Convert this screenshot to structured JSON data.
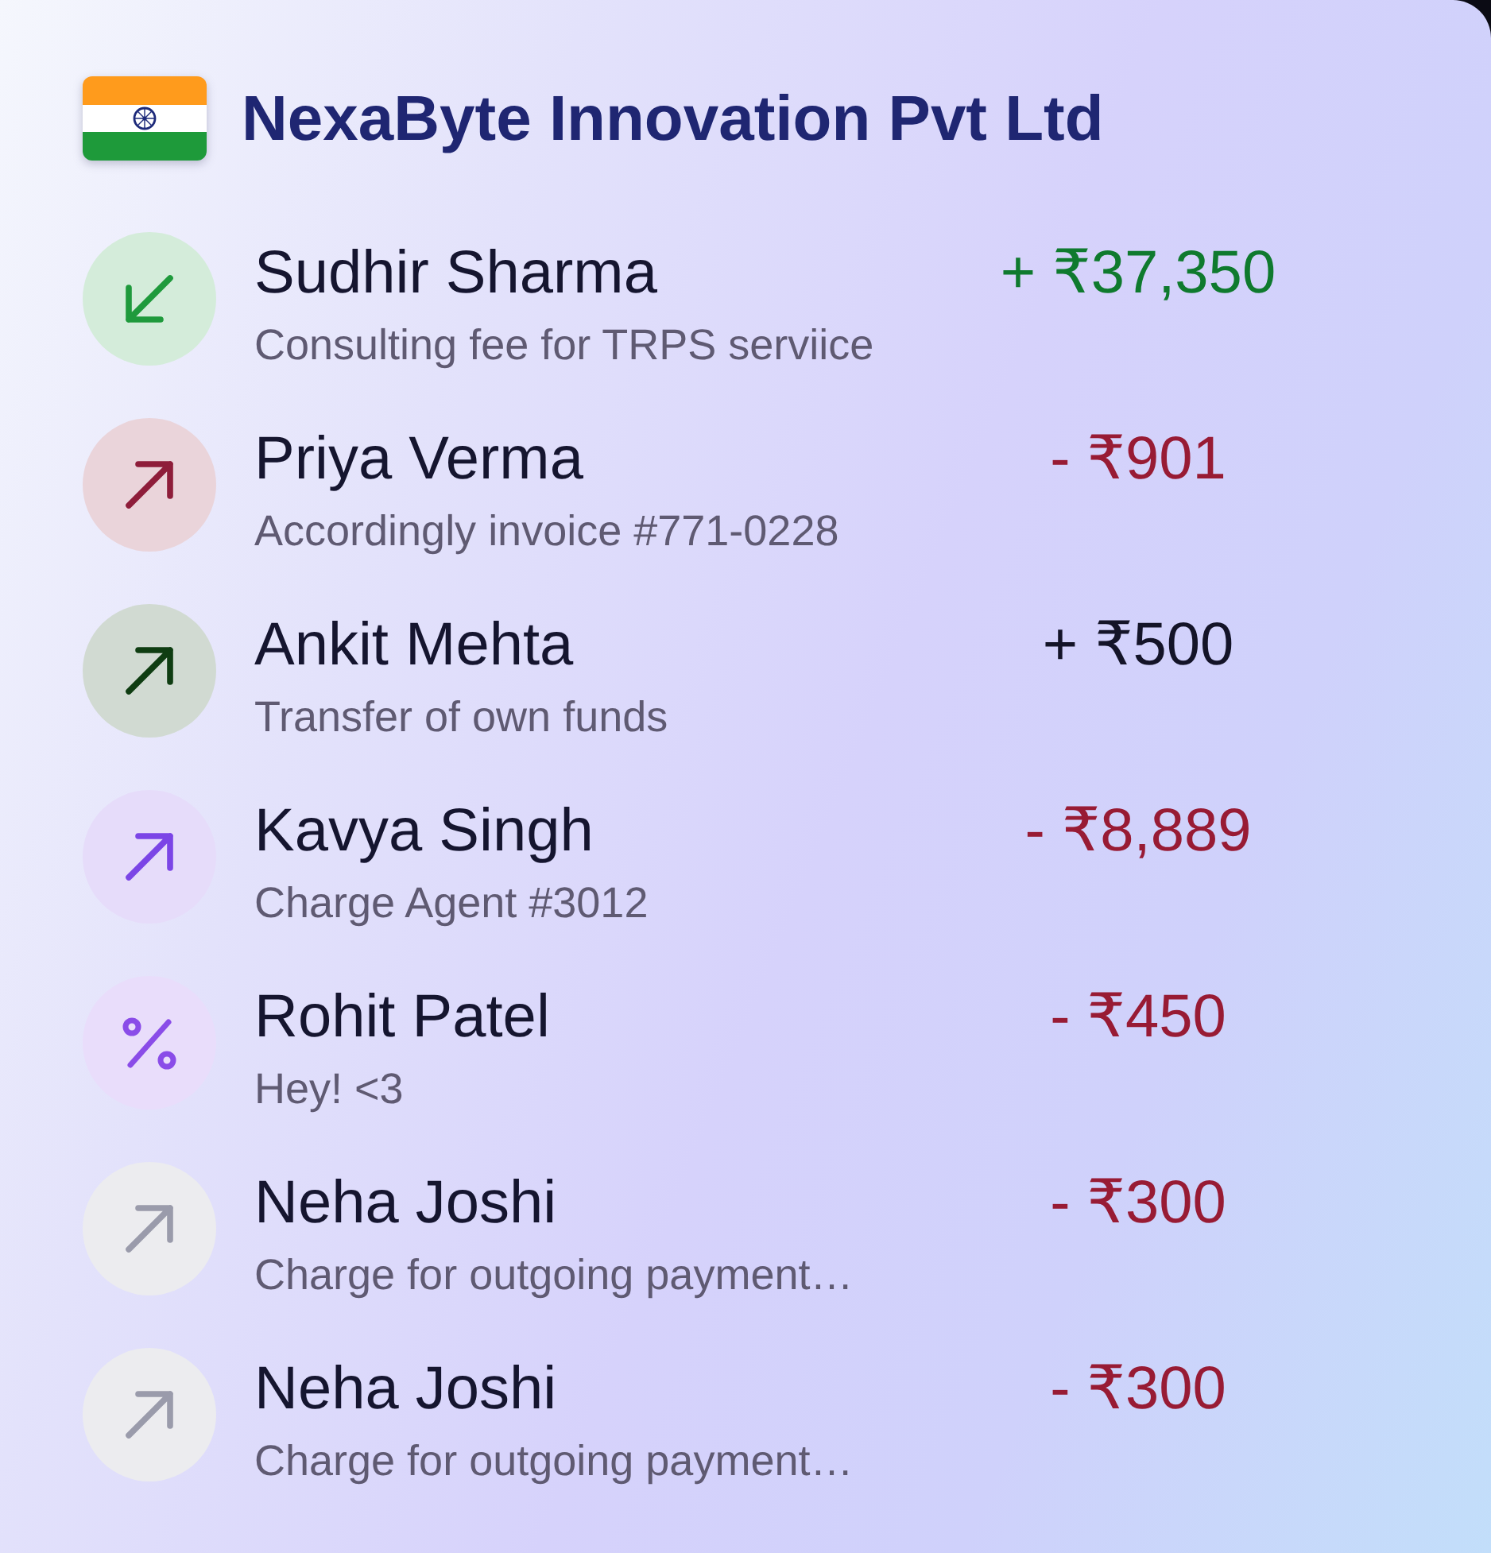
{
  "header": {
    "title": "NexaByte Innovation Pvt Ltd"
  },
  "transactions": [
    {
      "name": "Sudhir Sharma",
      "description": "Consulting fee for TRPS serviice",
      "amount": {
        "text": "+ ₹37,350",
        "color": "#0f7a2e"
      },
      "icon": {
        "kind": "incoming",
        "color": "#1f9a3c"
      }
    },
    {
      "name": "Priya Verma",
      "description": "Accordingly invoice #771-0228",
      "amount": {
        "text": "- ₹901",
        "color": "#981b34"
      },
      "icon": {
        "kind": "outgoing",
        "color": "#8e1d3a"
      }
    },
    {
      "name": "Ankit Mehta",
      "description": "Transfer of own funds",
      "amount": {
        "text": "+ ₹500",
        "color": "#141428"
      },
      "icon": {
        "kind": "outgoing",
        "color": "#0f3d12"
      }
    },
    {
      "name": "Kavya Singh",
      "description": "Charge Agent #3012",
      "amount": {
        "text": "- ₹8,889",
        "color": "#981b34"
      },
      "icon": {
        "kind": "outgoing",
        "color": "#7b45e6"
      }
    },
    {
      "name": "Rohit Patel",
      "description": "Hey! <3",
      "amount": {
        "text": "- ₹450",
        "color": "#981b34"
      },
      "icon": {
        "kind": "percent",
        "color": "#8a4ce8"
      }
    },
    {
      "name": "Neha Joshi",
      "description": "Charge for outgoing payment…",
      "amount": {
        "text": "- ₹300",
        "color": "#981b34"
      },
      "icon": {
        "kind": "outgoing",
        "color": "#9a9bab"
      }
    },
    {
      "name": "Neha Joshi",
      "description": "Charge for outgoing payment…",
      "amount": {
        "text": "- ₹300",
        "color": "#981b34"
      },
      "icon": {
        "kind": "outgoing",
        "color": "#9a9bab"
      }
    }
  ]
}
